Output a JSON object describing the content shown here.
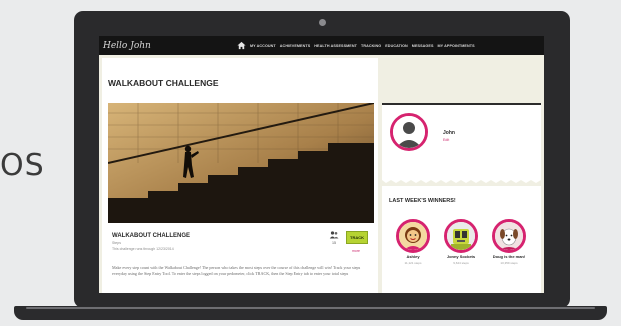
{
  "background_text": "OS",
  "topbar": {
    "brand": "Hello John",
    "nav": [
      "MY ACCOUNT",
      "ACHIEVEMENTS",
      "HEALTH ASSESSMENT",
      "TRACKING",
      "EDUCATION",
      "MESSAGES",
      "MY APPOINTMENTS"
    ]
  },
  "main": {
    "page_title": "WALKABOUT CHALLENGE",
    "card": {
      "title": "WALKABOUT CHALLENGE",
      "subtitle": "Steps",
      "date": "This challenge runs through 12/23/2014",
      "participant_count": "15",
      "track_label": "TRACK",
      "more_label": "more"
    },
    "body": "Make every step count with the Walkabout Challenge! The person who takes the most steps over the course of this challenge will win! Track your steps everyday using the Step Entry Tool. To enter the steps logged on your pedometer, click TRACK, then the Step Entry tab to enter your total steps"
  },
  "profile": {
    "name": "John",
    "link": "Edit"
  },
  "winners": {
    "title": "LAST WEEK'S WINNERS!",
    "items": [
      {
        "name": "Ashley",
        "steps": "11,121 steps"
      },
      {
        "name": "Jonny Sockets",
        "steps": "9,644 steps"
      },
      {
        "name": "Doug is the man!",
        "steps": "10,359 steps"
      }
    ]
  },
  "colors": {
    "accent": "#d6236f",
    "track_button": "#b6d332",
    "topbar": "#141414"
  }
}
